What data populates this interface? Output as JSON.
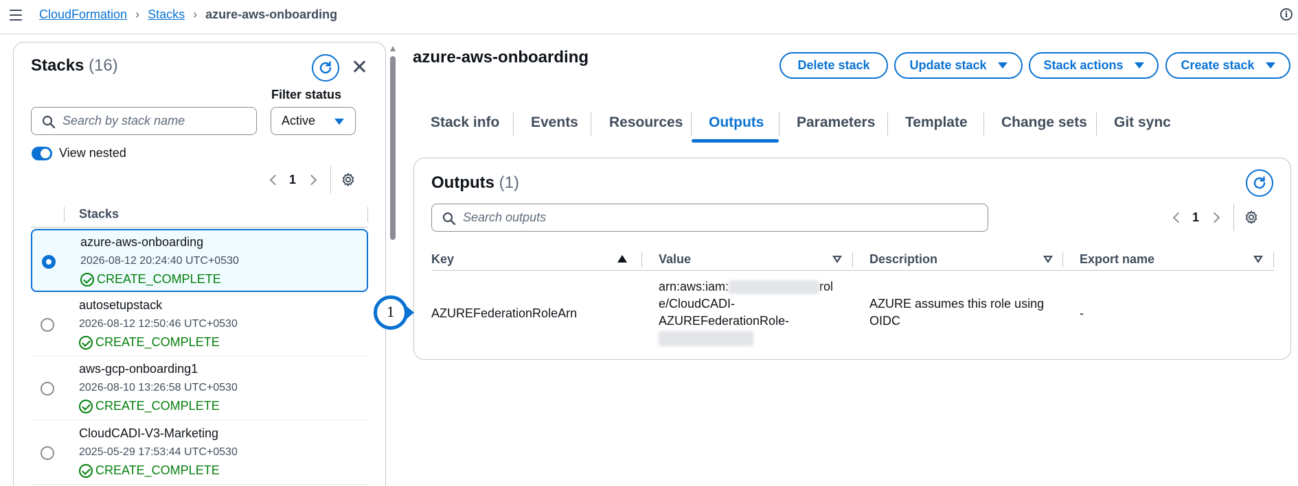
{
  "breadcrumb": {
    "items": [
      "CloudFormation",
      "Stacks"
    ],
    "current": "azure-aws-onboarding"
  },
  "icons": {
    "menu": "hamburger-menu-icon",
    "info": "info-icon",
    "refresh": "refresh-icon",
    "close": "close-icon",
    "search": "search-icon",
    "settings": "gear-icon",
    "success": "check-circle-icon"
  },
  "colors": {
    "accent": "#0972d3",
    "success": "#037f0c",
    "border": "#c6c6cd"
  },
  "stacks_panel": {
    "title": "Stacks",
    "count": "(16)",
    "filter_label": "Filter status",
    "filter_value": "Active",
    "search_placeholder": "Search by stack name",
    "view_nested_label": "View nested",
    "view_nested_on": true,
    "page": "1",
    "column_header": "Stacks",
    "stacks": [
      {
        "name": "azure-aws-onboarding",
        "date": "2026-08-12 20:24:40 UTC+0530",
        "status": "CREATE_COMPLETE",
        "selected": true
      },
      {
        "name": "autosetupstack",
        "date": "2026-08-12 12:50:46 UTC+0530",
        "status": "CREATE_COMPLETE",
        "selected": false
      },
      {
        "name": "aws-gcp-onboarding1",
        "date": "2026-08-10 13:26:58 UTC+0530",
        "status": "CREATE_COMPLETE",
        "selected": false
      },
      {
        "name": "CloudCADI-V3-Marketing",
        "date": "2025-05-29 17:53:44 UTC+0530",
        "status": "CREATE_COMPLETE",
        "selected": false
      }
    ]
  },
  "main": {
    "title": "azure-aws-onboarding",
    "buttons": {
      "delete": "Delete stack",
      "update": "Update stack",
      "actions": "Stack actions",
      "create": "Create stack"
    },
    "tabs": [
      "Stack info",
      "Events",
      "Resources",
      "Outputs",
      "Parameters",
      "Template",
      "Change sets",
      "Git sync"
    ],
    "active_tab": "Outputs"
  },
  "outputs": {
    "title": "Outputs",
    "count": "(1)",
    "search_placeholder": "Search outputs",
    "page": "1",
    "columns": [
      "Key",
      "Value",
      "Description",
      "Export name"
    ],
    "rows": [
      {
        "key": "AZUREFederationRoleArn",
        "value_line1_prefix": "arn:aws:iam:",
        "value_line1_suffix": "rol",
        "value_line2": "e/CloudCADI-",
        "value_line3": "AZUREFederationRole-",
        "description_line1": "AZURE assumes this role using",
        "description_line2": "OIDC",
        "export_name": "-"
      }
    ]
  },
  "annotation": {
    "callout_number": "1"
  }
}
